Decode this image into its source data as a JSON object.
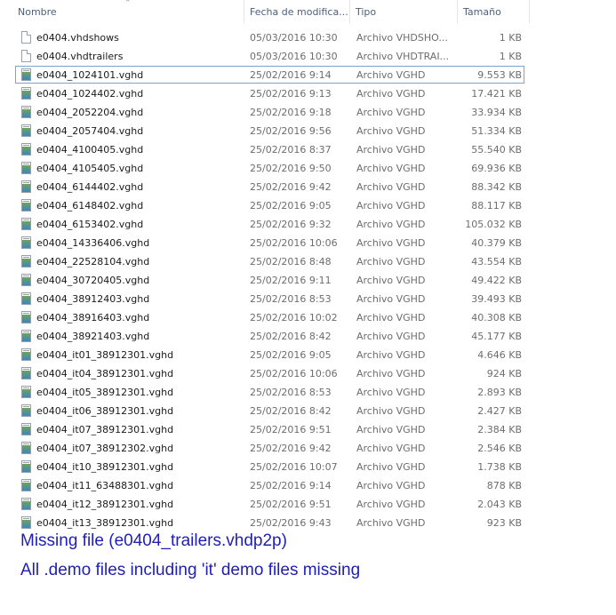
{
  "columns": {
    "name": "Nombre",
    "date": "Fecha de modifica...",
    "type": "Tipo",
    "size": "Tamaño"
  },
  "files": [
    {
      "name": "e0404.vhdshows",
      "date": "05/03/2016 10:30",
      "type": "Archivo VHDSHO...",
      "size": "1 KB",
      "icon": "generic-file-icon"
    },
    {
      "name": "e0404.vhdtrailers",
      "date": "05/03/2016 10:30",
      "type": "Archivo VHDTRAI...",
      "size": "1 KB",
      "icon": "generic-file-icon"
    },
    {
      "name": "e0404_1024101.vghd",
      "date": "25/02/2016 9:14",
      "type": "Archivo VGHD",
      "size": "9.553 KB",
      "icon": "image-file-icon",
      "selected": true
    },
    {
      "name": "e0404_1024402.vghd",
      "date": "25/02/2016 9:13",
      "type": "Archivo VGHD",
      "size": "17.421 KB",
      "icon": "image-file-icon"
    },
    {
      "name": "e0404_2052204.vghd",
      "date": "25/02/2016 9:18",
      "type": "Archivo VGHD",
      "size": "33.934 KB",
      "icon": "image-file-icon"
    },
    {
      "name": "e0404_2057404.vghd",
      "date": "25/02/2016 9:56",
      "type": "Archivo VGHD",
      "size": "51.334 KB",
      "icon": "image-file-icon"
    },
    {
      "name": "e0404_4100405.vghd",
      "date": "25/02/2016 8:37",
      "type": "Archivo VGHD",
      "size": "55.540 KB",
      "icon": "image-file-icon"
    },
    {
      "name": "e0404_4105405.vghd",
      "date": "25/02/2016 9:50",
      "type": "Archivo VGHD",
      "size": "69.936 KB",
      "icon": "image-file-icon"
    },
    {
      "name": "e0404_6144402.vghd",
      "date": "25/02/2016 9:42",
      "type": "Archivo VGHD",
      "size": "88.342 KB",
      "icon": "image-file-icon"
    },
    {
      "name": "e0404_6148402.vghd",
      "date": "25/02/2016 9:05",
      "type": "Archivo VGHD",
      "size": "88.117 KB",
      "icon": "image-file-icon"
    },
    {
      "name": "e0404_6153402.vghd",
      "date": "25/02/2016 9:32",
      "type": "Archivo VGHD",
      "size": "105.032 KB",
      "icon": "image-file-icon"
    },
    {
      "name": "e0404_14336406.vghd",
      "date": "25/02/2016 10:06",
      "type": "Archivo VGHD",
      "size": "40.379 KB",
      "icon": "image-file-icon"
    },
    {
      "name": "e0404_22528104.vghd",
      "date": "25/02/2016 8:48",
      "type": "Archivo VGHD",
      "size": "43.554 KB",
      "icon": "image-file-icon"
    },
    {
      "name": "e0404_30720405.vghd",
      "date": "25/02/2016 9:11",
      "type": "Archivo VGHD",
      "size": "49.422 KB",
      "icon": "image-file-icon"
    },
    {
      "name": "e0404_38912403.vghd",
      "date": "25/02/2016 8:53",
      "type": "Archivo VGHD",
      "size": "39.493 KB",
      "icon": "image-file-icon"
    },
    {
      "name": "e0404_38916403.vghd",
      "date": "25/02/2016 10:02",
      "type": "Archivo VGHD",
      "size": "40.308 KB",
      "icon": "image-file-icon"
    },
    {
      "name": "e0404_38921403.vghd",
      "date": "25/02/2016 8:42",
      "type": "Archivo VGHD",
      "size": "45.177 KB",
      "icon": "image-file-icon"
    },
    {
      "name": "e0404_it01_38912301.vghd",
      "date": "25/02/2016 9:05",
      "type": "Archivo VGHD",
      "size": "4.646 KB",
      "icon": "image-file-icon"
    },
    {
      "name": "e0404_it04_38912301.vghd",
      "date": "25/02/2016 10:06",
      "type": "Archivo VGHD",
      "size": "924 KB",
      "icon": "image-file-icon"
    },
    {
      "name": "e0404_it05_38912301.vghd",
      "date": "25/02/2016 8:53",
      "type": "Archivo VGHD",
      "size": "2.893 KB",
      "icon": "image-file-icon"
    },
    {
      "name": "e0404_it06_38912301.vghd",
      "date": "25/02/2016 8:42",
      "type": "Archivo VGHD",
      "size": "2.427 KB",
      "icon": "image-file-icon"
    },
    {
      "name": "e0404_it07_38912301.vghd",
      "date": "25/02/2016 9:51",
      "type": "Archivo VGHD",
      "size": "2.384 KB",
      "icon": "image-file-icon"
    },
    {
      "name": "e0404_it07_38912302.vghd",
      "date": "25/02/2016 9:42",
      "type": "Archivo VGHD",
      "size": "2.546 KB",
      "icon": "image-file-icon"
    },
    {
      "name": "e0404_it10_38912301.vghd",
      "date": "25/02/2016 10:07",
      "type": "Archivo VGHD",
      "size": "1.738 KB",
      "icon": "image-file-icon"
    },
    {
      "name": "e0404_it11_63488301.vghd",
      "date": "25/02/2016 9:14",
      "type": "Archivo VGHD",
      "size": "878 KB",
      "icon": "image-file-icon"
    },
    {
      "name": "e0404_it12_38912301.vghd",
      "date": "25/02/2016 9:51",
      "type": "Archivo VGHD",
      "size": "2.043 KB",
      "icon": "image-file-icon"
    },
    {
      "name": "e0404_it13_38912301.vghd",
      "date": "25/02/2016 9:43",
      "type": "Archivo VGHD",
      "size": "923 KB",
      "icon": "image-file-icon"
    }
  ],
  "notes": {
    "line1": "Missing file (e0404_trailers.vhdp2p)",
    "line2": "All .demo files including 'it' demo files missing"
  },
  "colors": {
    "note_text": "#1f1fb3",
    "selection_border": "#7da2ce",
    "header_text": "#4c607a"
  }
}
